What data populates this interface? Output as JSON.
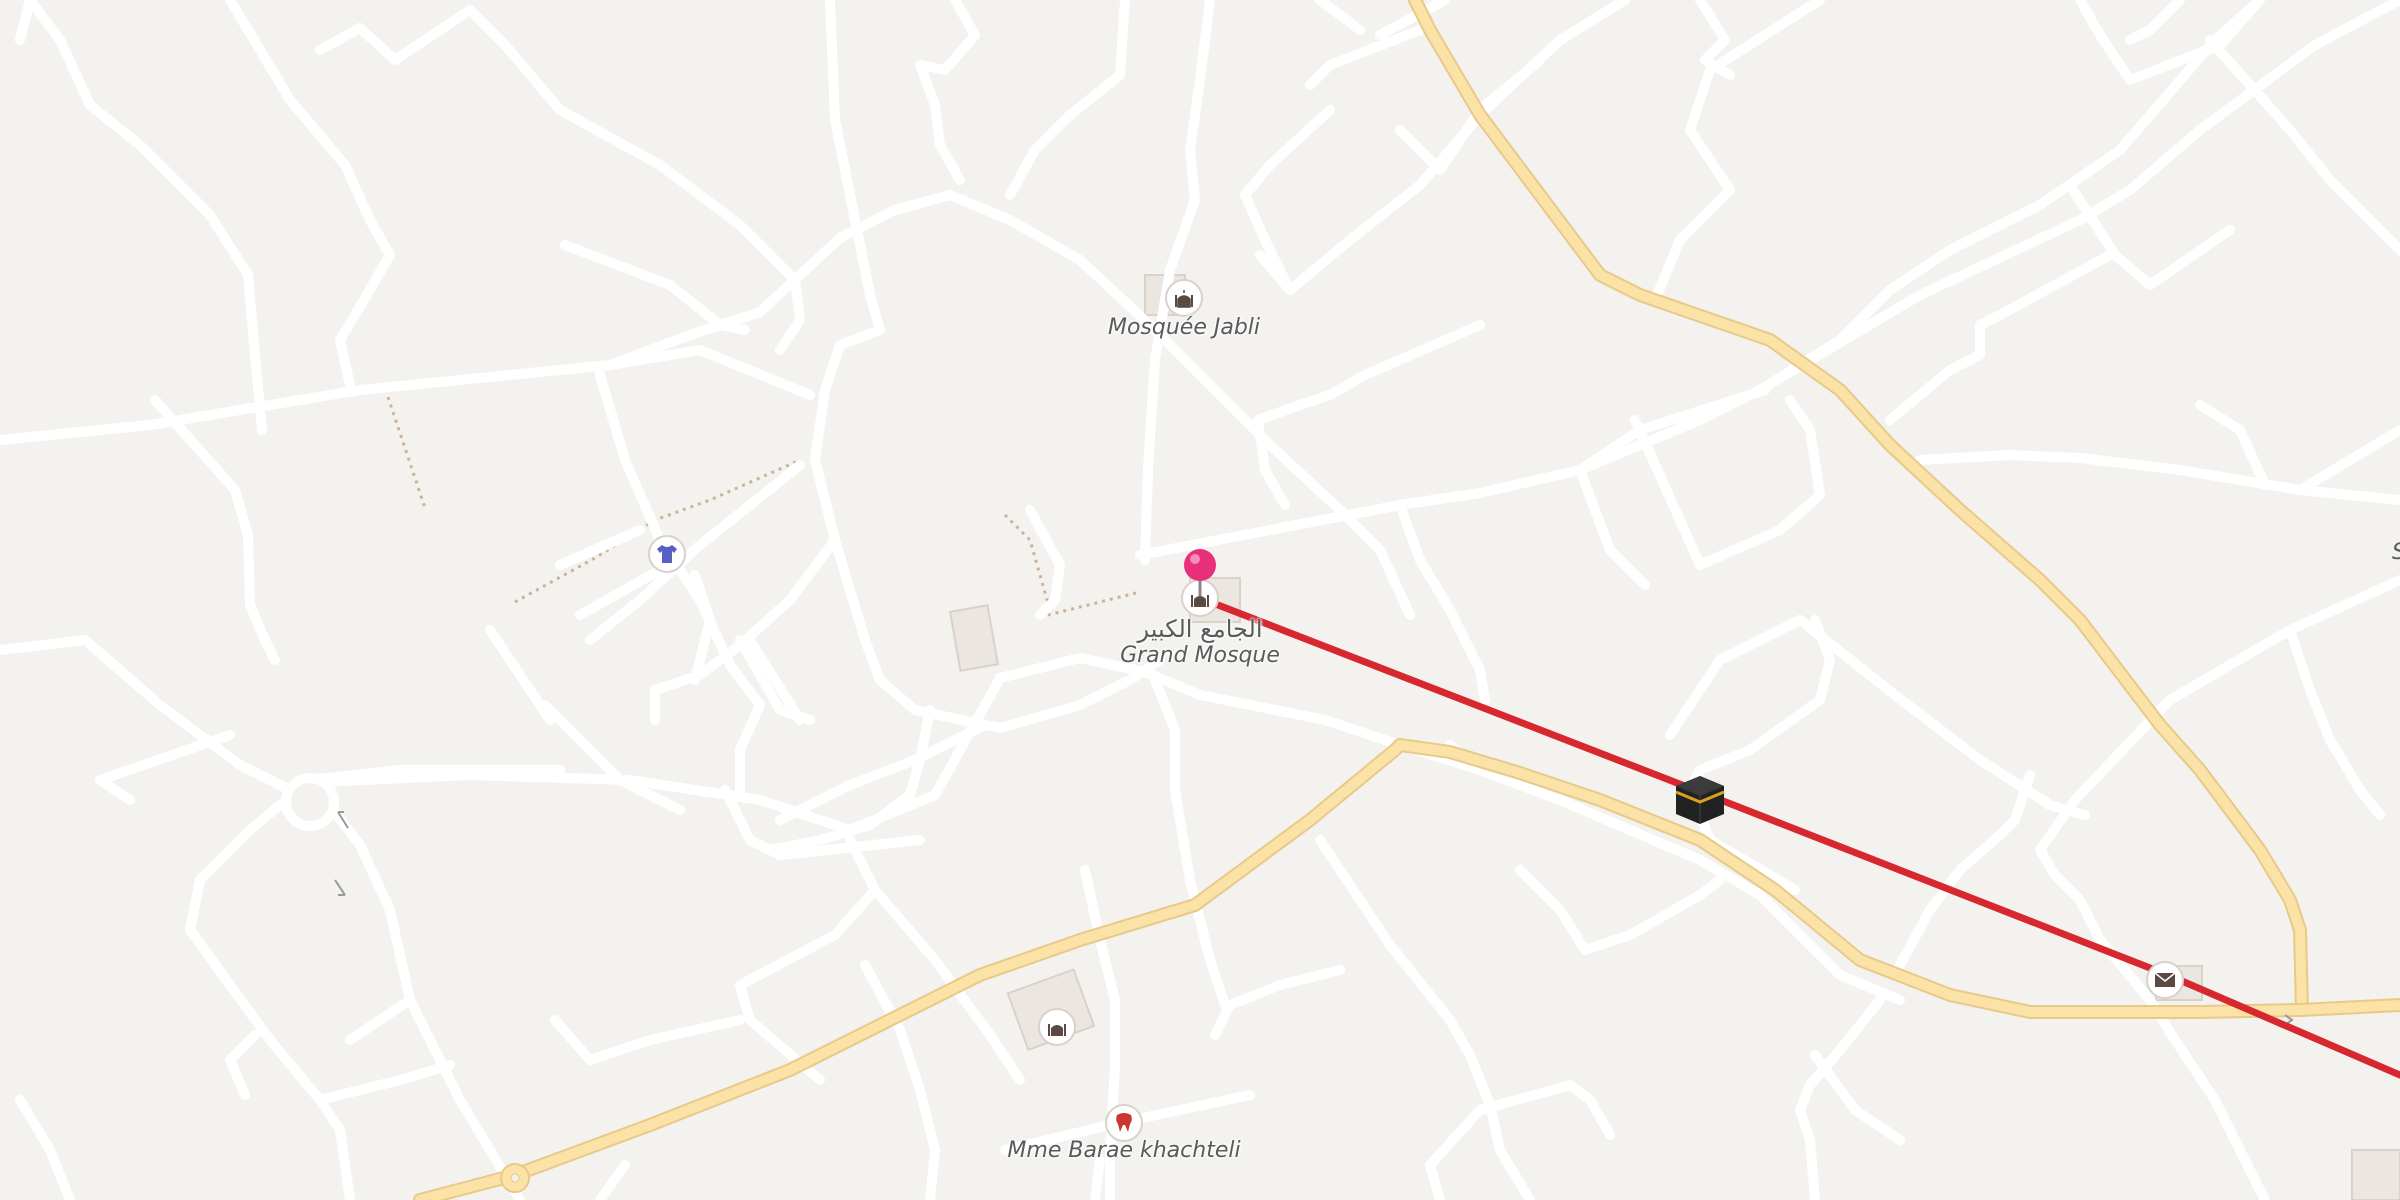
{
  "map": {
    "colors": {
      "background": "#f4f2ef",
      "minor_road": "#ffffff",
      "major_road": "#fbe2a6",
      "route_line": "#d7282f",
      "pin": "#e8307a"
    },
    "labels": {
      "mosquee_jabli": "Mosquée Jabli",
      "grand_mosque_ar": "الجامع الكبير",
      "grand_mosque_en": "Grand Mosque",
      "dentist": "Mme Barae khachteli",
      "edge_fragment": "S"
    },
    "icons": {
      "mosque": "mosque-icon",
      "clothes": "shirt-icon",
      "kaaba": "kaaba-icon",
      "dentist": "tooth-icon",
      "post": "envelope-icon",
      "pin": "location-pin-icon"
    }
  }
}
